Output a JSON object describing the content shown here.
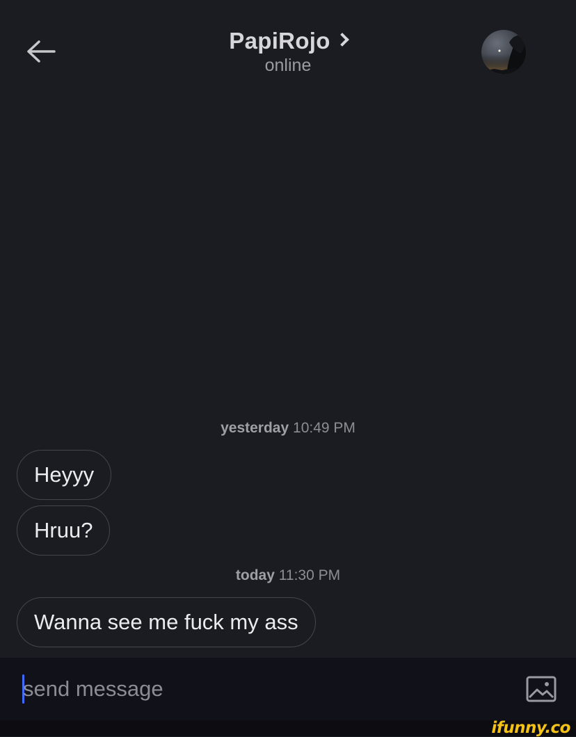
{
  "header": {
    "title": "PapiRojo",
    "status": "online"
  },
  "messages": {
    "group1": {
      "day": "yesterday",
      "time": "10:49 PM",
      "items": [
        "Heyyy",
        "Hruu?"
      ]
    },
    "group2": {
      "day": "today",
      "time": "11:30 PM",
      "items": [
        "Wanna see me fuck my ass"
      ]
    }
  },
  "composer": {
    "placeholder": "send message"
  },
  "watermark": "ifunny.co",
  "colors": {
    "background": "#1b1c21",
    "composer_background": "#101119",
    "bubble_border": "#45464c",
    "cursor": "#3f6bff",
    "watermark": "#f5c217"
  },
  "icons": [
    "back-arrow-icon",
    "chevron-right-icon",
    "image-icon"
  ]
}
